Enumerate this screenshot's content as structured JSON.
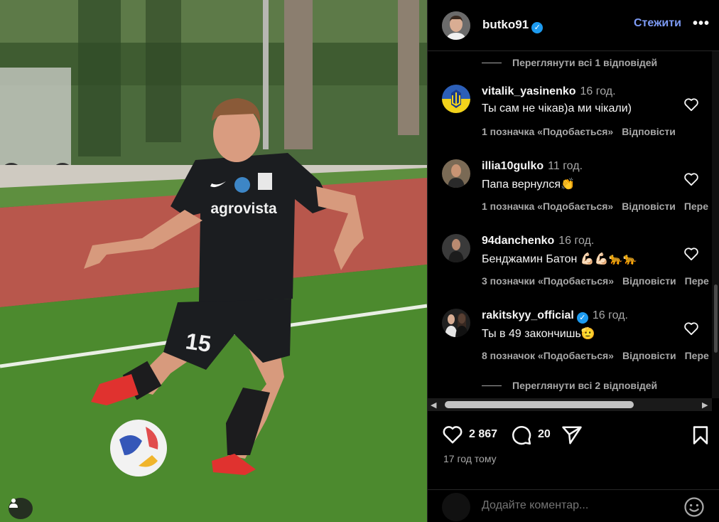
{
  "colors": {
    "background": "#000000",
    "accent_link": "#7d9bf5",
    "secondary_text": "#a8a8a8",
    "verified": "#1d9bf0",
    "jersey": "#1b1d20",
    "boots": "#e0322f"
  },
  "photo": {
    "jersey_sponsor": "agrovista",
    "shirt_number": "15",
    "user_tag_icon": "person-icon"
  },
  "header": {
    "username": "butko91",
    "verified": true,
    "follow_label": "Стежити",
    "more_icon": "more-horizontal-icon",
    "more_label": "•••"
  },
  "comments": {
    "view_replies_top": "Переглянути всі 1 відповідей",
    "view_replies_bottom": "Переглянути всі 2 відповідей",
    "items": [
      {
        "username": "vitalik_yasinenko",
        "time": "16 год.",
        "text": "Ты сам не чікав)а ми чікали)",
        "likes": "1 позначка «Подобається»",
        "reply": "Відповісти",
        "translate": "",
        "verified": false
      },
      {
        "username": "illia10gulko",
        "time": "11 год.",
        "text": "Папа вернулся👏",
        "likes": "1 позначка «Подобається»",
        "reply": "Відповісти",
        "translate": "Пере",
        "verified": false
      },
      {
        "username": "94danchenko",
        "time": "16 год.",
        "text": "Бенджамин Батон 💪🏻💪🏻🐆🐆",
        "likes": "3 позначки «Подобається»",
        "reply": "Відповісти",
        "translate": "Пере",
        "verified": false
      },
      {
        "username": "rakitskyy_official",
        "time": "16 год.",
        "text": "Ты в 49 закончишь🫡",
        "likes": "8 позначок «Подобається»",
        "reply": "Відповісти",
        "translate": "Пере",
        "verified": true
      }
    ]
  },
  "actions": {
    "like_count": "2 867",
    "comment_count": "20",
    "posted": "17 год тому"
  },
  "add_comment": {
    "placeholder": "Додайте коментар..."
  }
}
